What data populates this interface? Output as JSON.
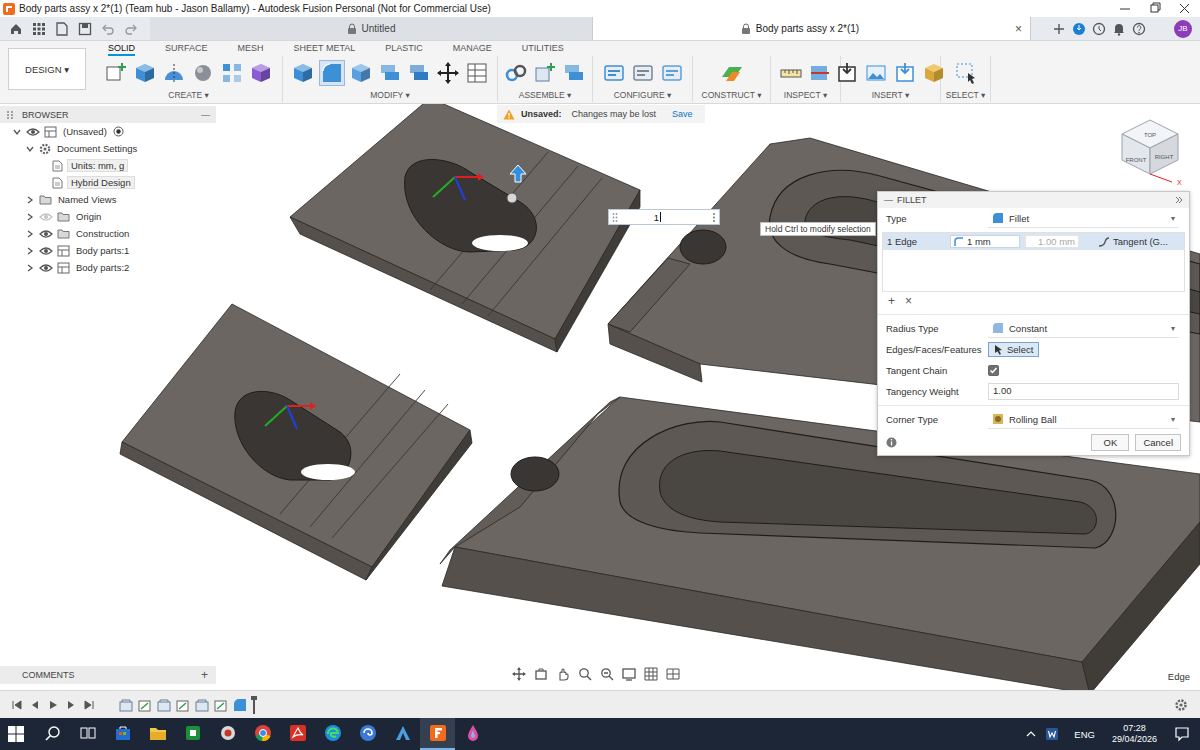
{
  "window": {
    "title": "Body parts assy x 2*(1) (Team hub - Jason Ballamy) - Autodesk Fusion Personal (Not for Commercial Use)"
  },
  "doc_tabs": [
    {
      "label": "Untitled",
      "selected": false,
      "locked": true
    },
    {
      "label": "Body parts assy x 2*(1)",
      "selected": true,
      "locked": true
    }
  ],
  "tab_close": "×",
  "user_initials": "JB",
  "workspace": {
    "label": "DESIGN",
    "caret": "▾"
  },
  "toolbar_tabs": [
    {
      "label": "SOLID",
      "selected": true
    },
    {
      "label": "SURFACE",
      "selected": false
    },
    {
      "label": "MESH",
      "selected": false
    },
    {
      "label": "SHEET METAL",
      "selected": false
    },
    {
      "label": "PLASTIC",
      "selected": false
    },
    {
      "label": "MANAGE",
      "selected": false
    },
    {
      "label": "UTILITIES",
      "selected": false
    }
  ],
  "toolbar_groups": [
    {
      "label": "CREATE",
      "caret": "▾",
      "tools": [
        {
          "selected": false
        },
        {
          "selected": false
        },
        {
          "selected": false
        },
        {
          "selected": false
        },
        {
          "selected": false
        },
        {
          "selected": false
        }
      ]
    },
    {
      "label": "MODIFY",
      "caret": "▾",
      "tools": [
        {
          "selected": false
        },
        {
          "selected": true
        },
        {
          "selected": false
        },
        {
          "selected": false
        },
        {
          "selected": false
        },
        {
          "selected": false
        },
        {
          "selected": false
        }
      ]
    },
    {
      "label": "ASSEMBLE",
      "caret": "▾",
      "tools": [
        {
          "selected": false
        },
        {
          "selected": false
        },
        {
          "selected": false
        }
      ]
    },
    {
      "label": "CONFIGURE",
      "caret": "▾",
      "tools": [
        {
          "selected": false
        },
        {
          "selected": false
        },
        {
          "selected": false
        }
      ]
    },
    {
      "label": "CONSTRUCT",
      "caret": "▾",
      "tools": [
        {
          "selected": false
        }
      ]
    },
    {
      "label": "INSPECT",
      "caret": "▾",
      "tools": [
        {
          "selected": false
        },
        {
          "selected": false
        }
      ]
    },
    {
      "label": "INSERT",
      "caret": "▾",
      "tools": [
        {
          "selected": false
        },
        {
          "selected": false
        },
        {
          "selected": false
        },
        {
          "selected": false
        }
      ]
    },
    {
      "label": "SELECT",
      "caret": "▾",
      "tools": [
        {
          "selected": false
        }
      ]
    }
  ],
  "browser": {
    "title": "BROWSER",
    "collapse": "—",
    "items": [
      {
        "label": "(Unsaved)",
        "depth": 0,
        "kind": "root",
        "expanded": true,
        "visible": true
      },
      {
        "label": "Document Settings",
        "depth": 1,
        "kind": "settings",
        "expanded": true,
        "visible": true
      },
      {
        "label": "Units: mm, g",
        "depth": 2,
        "kind": "setting",
        "expanded": false,
        "visible": true
      },
      {
        "label": "Hybrid Design",
        "depth": 2,
        "kind": "setting",
        "expanded": false,
        "visible": true
      },
      {
        "label": "Named Views",
        "depth": 1,
        "kind": "folder",
        "expanded": false,
        "visible": true
      },
      {
        "label": "Origin",
        "depth": 1,
        "kind": "eyefolder",
        "expanded": false,
        "visible": false
      },
      {
        "label": "Construction",
        "depth": 1,
        "kind": "eyefolder",
        "expanded": false,
        "visible": true
      },
      {
        "label": "Body parts:1",
        "depth": 1,
        "kind": "component",
        "expanded": false,
        "visible": true
      },
      {
        "label": "Body parts:2",
        "depth": 1,
        "kind": "component",
        "expanded": false,
        "visible": true
      }
    ]
  },
  "unsaved_banner": {
    "label": "Unsaved:",
    "message": "Changes may be lost",
    "action": "Save"
  },
  "value_input": {
    "value": "1"
  },
  "tooltip": {
    "text": "Hold Ctrl to modify selection"
  },
  "fillet": {
    "title": "FILLET",
    "collapse": "—",
    "caret": "▾",
    "type": {
      "label": "Type",
      "value": "Fillet"
    },
    "selection": {
      "count": "1 Edge",
      "radius": "1 mm",
      "radius2": "1.00 mm",
      "continuity": "Tangent (G...",
      "selected": true
    },
    "add": "+",
    "remove": "×",
    "radius_type": {
      "label": "Radius Type",
      "value": "Constant"
    },
    "edges": {
      "label": "Edges/Faces/Features",
      "button": "Select",
      "selected": true
    },
    "tangent_chain": {
      "label": "Tangent Chain",
      "checked": true
    },
    "tangency_weight": {
      "label": "Tangency Weight",
      "value": "1.00"
    },
    "corner_type": {
      "label": "Corner Type",
      "value": "Rolling Ball"
    },
    "buttons": [
      "OK",
      "Cancel"
    ]
  },
  "viewcube": {
    "faces": [
      "TOP",
      "FRONT",
      "RIGHT"
    ],
    "axis": "X"
  },
  "comments": {
    "label": "COMMENTS",
    "add": "+"
  },
  "selection_status": "Edge",
  "taskbar": {
    "apps": [
      {
        "selected": false
      },
      {
        "selected": false
      },
      {
        "selected": false
      },
      {
        "selected": false
      },
      {
        "selected": false
      },
      {
        "selected": false
      },
      {
        "selected": false
      },
      {
        "selected": false
      },
      {
        "selected": false
      },
      {
        "selected": true
      },
      {
        "selected": false
      }
    ],
    "language": "ENG",
    "time": "07:28",
    "date": "29/04/2026"
  }
}
